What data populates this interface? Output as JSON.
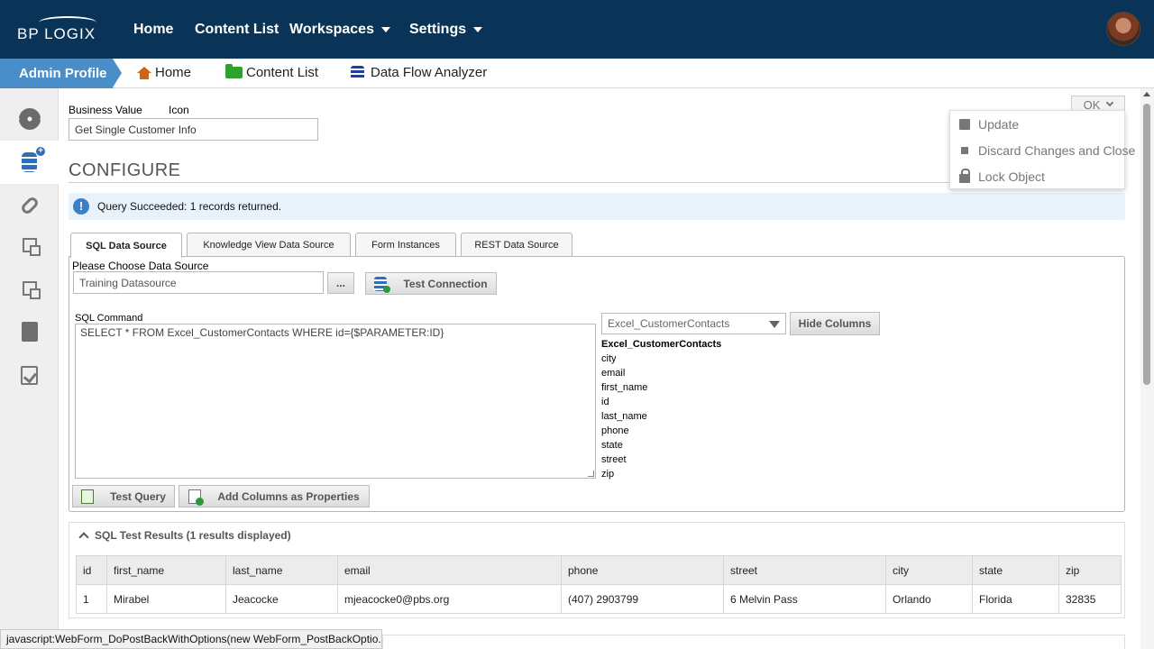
{
  "topnav": {
    "logo": "BP LOGIX",
    "items": [
      "Home",
      "Content List",
      "Workspaces",
      "Settings"
    ]
  },
  "breadcrumb": {
    "admin": "Admin Profile",
    "items": [
      "Home",
      "Content List",
      "Data Flow Analyzer"
    ]
  },
  "sidebar": {
    "icons": [
      "gears-icon",
      "database-add-icon",
      "link-icon",
      "diagram-icon",
      "copy-icon",
      "locked-file-icon",
      "checklist-icon"
    ]
  },
  "form": {
    "business_value_label": "Business Value",
    "icon_label": "Icon",
    "business_value": "Get Single Customer Info"
  },
  "section_title": "CONFIGURE",
  "alert": "Query Succeeded: 1 records returned.",
  "tabs": [
    "SQL Data Source",
    "Knowledge View Data Source",
    "Form Instances",
    "REST Data Source"
  ],
  "sql": {
    "datasource_label": "Please Choose Data Source",
    "datasource": "Training Datasource",
    "browse_label": "...",
    "test_connection": "Test Connection",
    "command_label": "SQL Command",
    "command": "SELECT * FROM Excel_CustomerContacts WHERE id={$PARAMETER:ID}",
    "table_select": "Excel_CustomerContacts",
    "hide_columns": "Hide Columns",
    "columns_header": "Excel_CustomerContacts",
    "columns": [
      "city",
      "email",
      "first_name",
      "id",
      "last_name",
      "phone",
      "state",
      "street",
      "zip"
    ],
    "test_query": "Test Query",
    "add_columns": "Add Columns as Properties"
  },
  "results": {
    "title": "SQL Test Results (1 results displayed)",
    "headers": [
      "id",
      "first_name",
      "last_name",
      "email",
      "phone",
      "street",
      "city",
      "state",
      "zip"
    ],
    "rows": [
      [
        "1",
        "Mirabel",
        "Jeacocke",
        "mjeacocke0@pbs.org",
        "(407) 2903799",
        "6 Melvin Pass",
        "Orlando",
        "Florida",
        "32835"
      ]
    ]
  },
  "ok_menu": {
    "button": "OK",
    "items": [
      "Update",
      "Discard Changes and Close",
      "Lock Object"
    ]
  },
  "statusbar": "javascript:WebForm_DoPostBackWithOptions(new WebForm_PostBackOptio...",
  "colors": {
    "nav": "#0a3457",
    "accent": "#4a8ec9",
    "alert_bg": "#e8f2fb"
  }
}
